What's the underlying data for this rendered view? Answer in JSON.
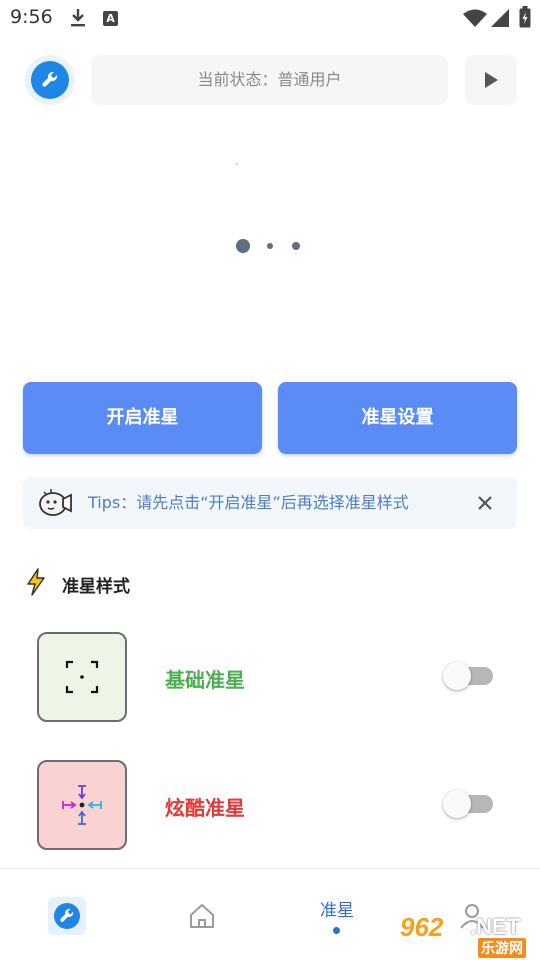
{
  "status_bar": {
    "time": "9:56",
    "a_badge": "A",
    "icons": [
      "download-icon",
      "a-badge-icon",
      "wifi-icon",
      "signal-icon",
      "battery-icon"
    ]
  },
  "header": {
    "status_text": "当前状态：普通用户",
    "logo_icon": "wrench-icon",
    "play_icon": "play-icon"
  },
  "carousel": {
    "page_count": 3,
    "active_index": 0
  },
  "actions": {
    "start_label": "开启准星",
    "settings_label": "准星设置"
  },
  "tips": {
    "text": "Tips：请先点击“开启准星”后再选择准星样式",
    "close_icon": "close-icon"
  },
  "section": {
    "title": "准星样式",
    "icon": "lightning-icon"
  },
  "crosshairs": [
    {
      "label": "基础准星",
      "enabled": false,
      "color": "#4caf50",
      "thumb_bg": "#eef5e6"
    },
    {
      "label": "炫酷准星",
      "enabled": false,
      "color": "#e53935",
      "thumb_bg": "#fbd2d2"
    }
  ],
  "bottom_nav": {
    "items": [
      {
        "icon": "wrench-icon"
      },
      {
        "icon": "home-icon"
      },
      {
        "label": "准星",
        "active": true
      },
      {
        "icon": "user-icon"
      }
    ],
    "accent": "#2f6fd3"
  },
  "watermark": {
    "number": "962",
    "suffix": ".NET",
    "sub": "乐游网"
  },
  "colors": {
    "primary_button": "#5b8cf5",
    "tips_text": "#4a7ec6",
    "logo_blue": "#1d86e6"
  }
}
